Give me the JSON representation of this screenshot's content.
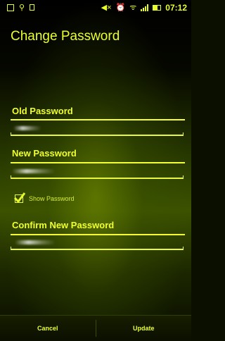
{
  "status_bar": {
    "left_icons": [
      "image-icon",
      "usb-icon",
      "phone-outline-icon"
    ],
    "right_icons": [
      "mute-icon",
      "alarm-icon",
      "wifi-icon",
      "signal-icon",
      "battery-icon"
    ],
    "time": "07:12"
  },
  "title": "Change Password",
  "fields": [
    {
      "label": "Old Password",
      "masked_value": "••••"
    },
    {
      "label": "New Password",
      "masked_value": "••••••••"
    },
    {
      "label": "Confirm New Password",
      "masked_value": "•••••••••"
    }
  ],
  "show_password": {
    "label": "Show Password",
    "checked": true
  },
  "buttons": {
    "cancel": "Cancel",
    "update": "Update"
  },
  "colors": {
    "accent": "#eaff2a",
    "background": "#0b0f00"
  }
}
